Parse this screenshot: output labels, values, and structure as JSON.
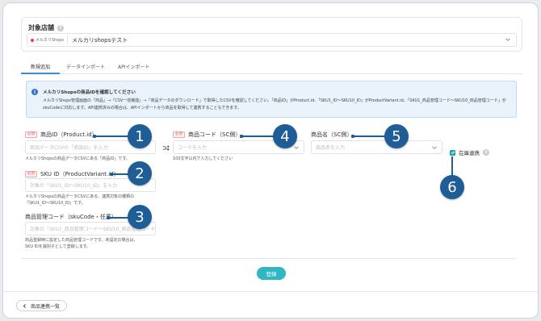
{
  "store": {
    "title": "対象店舗",
    "shop_logo_text": "メルカリShops",
    "selected_store": "メルカリshopsテスト"
  },
  "tabs": [
    {
      "label": "新規追加",
      "active": true
    },
    {
      "label": "データインポート",
      "active": false
    },
    {
      "label": "APIインポート",
      "active": false
    }
  ],
  "info": {
    "title": "メルカリShopsの商品IDを確認してください",
    "body": "メルカリShops管理画面の「商品」→「CSV一括機能」→「商品データのダウンロード」で取得したCSVを確認してください。「商品ID」がProduct.id、「SKU1_ID〜SKU10_ID」がProductVariant.id、「SKU1_商品管理コード〜SKU10_商品管理コード」がskuCodeに対応します。API連携済みの場合は、APIインポートから商品を取得して連携することもできます。"
  },
  "fields": {
    "required_badge": "必須",
    "product_id": {
      "label": "商品ID（Product.id）",
      "placeholder": "商品データCSVの「商品ID」を入力",
      "note": "メルカリShopsの商品データCSVにある「商品ID」です。"
    },
    "sku_id": {
      "label": "SKU ID（ProductVariant.id）",
      "placeholder": "対象の「SKU1_ID〜SKU10_ID」を入力",
      "note_line1": "メルカリShopsの商品データCSVにある、連携対象の種類の",
      "note_line2": "「SKU1_ID〜SKU10_ID」です。"
    },
    "sku_code": {
      "label": "商品管理コード（skuCode・任意）",
      "placeholder": "対象の「SKU1_商品管理コード〜SKU10_商品管理コード」",
      "note_line1": "商品登録時に設定した商品管理コードです。未設定の場合は、",
      "note_line2": "SKU IDを識別子として登録します。"
    },
    "product_code": {
      "label": "商品コード（SC側）",
      "placeholder": "コードを入力",
      "note": "100文字以内で入力してください"
    },
    "product_name": {
      "label": "商品名（SC側）",
      "placeholder": "商品名を入力"
    },
    "stock_sync": {
      "label": "在庫連携",
      "checked": true
    }
  },
  "callouts": [
    "1",
    "2",
    "3",
    "4",
    "5",
    "6"
  ],
  "submit_label": "登録",
  "back_label": "商品連携一覧",
  "colors": {
    "accent": "#2fb8c2",
    "callout": "#1f5d96",
    "info_bg": "#eaf2fc",
    "required": "#e65a5a"
  }
}
